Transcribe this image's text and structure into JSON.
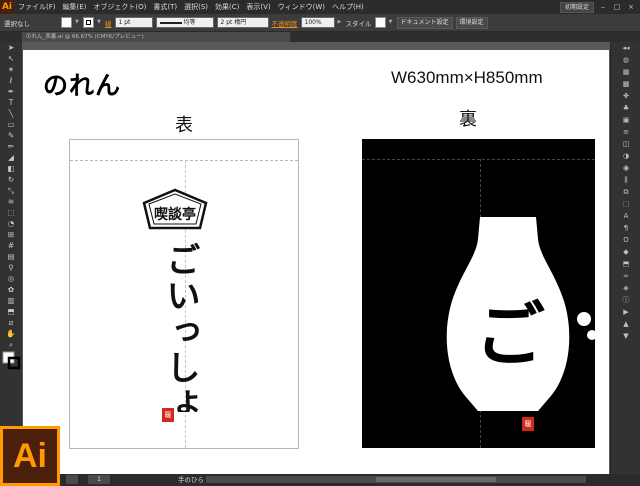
{
  "app": {
    "logo_small": "Ai",
    "logo_big": "Ai"
  },
  "menu": [
    "ファイル(F)",
    "編集(E)",
    "オブジェクト(O)",
    "書式(T)",
    "選択(S)",
    "効果(C)",
    "表示(V)",
    "ウィンドウ(W)",
    "ヘルプ(H)"
  ],
  "menu_right": {
    "workspace": "初期設定",
    "minimize": "‒",
    "restore": "□",
    "close": "×"
  },
  "control": {
    "selection": "選択なし",
    "stroke_label": "線",
    "stroke_weight": "1 pt",
    "profile_label": "均等",
    "brush_label": "2 pt 楕円",
    "opacity_label": "不透明度",
    "opacity_value": "100%",
    "style_label": "スタイル",
    "doc_setup": "ドキュメント設定",
    "prefs": "環境設定"
  },
  "document_tab": "のれん_表裏.ai @ 66.67% (CMYK/プレビュー)",
  "artboard": {
    "title": "のれん",
    "size": "W630mm×H850mm",
    "front_label": "表",
    "back_label": "裏",
    "emblem_text": "喫談亭",
    "calligraphy_text": "ごいっしょ",
    "seal_text": "暖",
    "bottle_text": "ご"
  },
  "status": {
    "page": "1",
    "tool": "手のひら"
  },
  "colors": {
    "menubar": "#2b2b2b",
    "panel": "#323232",
    "canvas": "#595959",
    "ai_orange": "#ff9a00",
    "ai_brown": "#4b1f0b",
    "seal_red": "#d1291b"
  }
}
